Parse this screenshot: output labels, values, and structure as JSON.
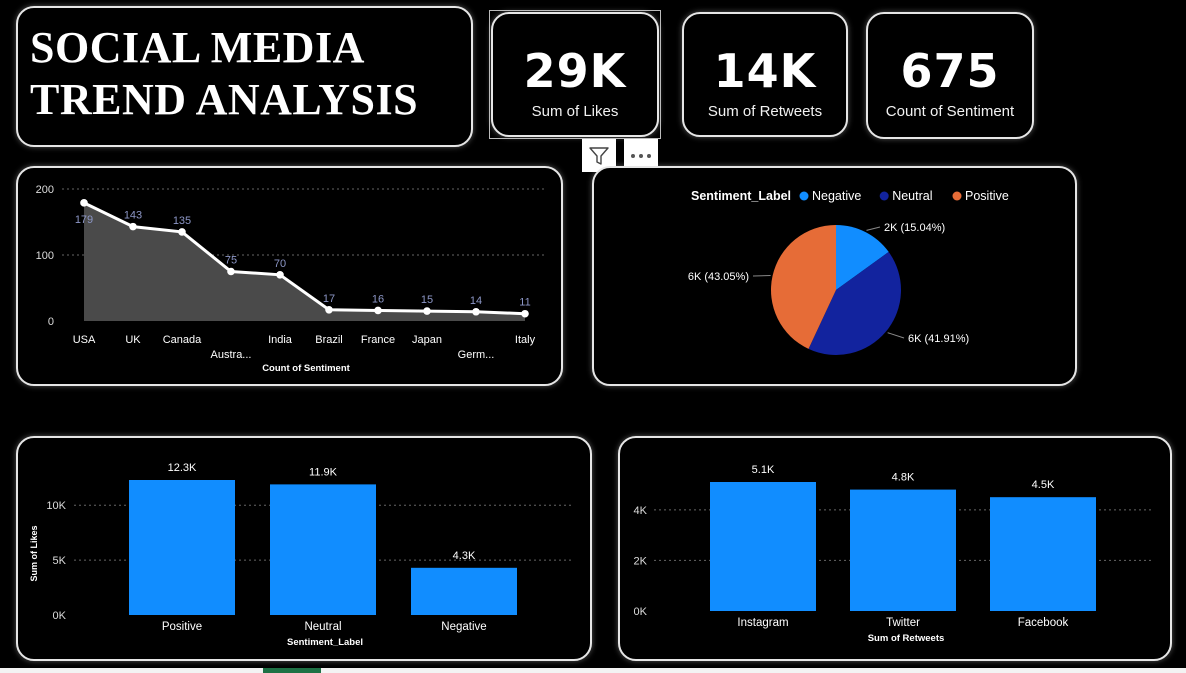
{
  "title": {
    "text": "SOCIAL MEDIA\nTREND ANALYSIS"
  },
  "kpis": [
    {
      "value": "29K",
      "label": "Sum of Likes"
    },
    {
      "value": "14K",
      "label": "Sum of Retweets"
    },
    {
      "value": "675",
      "label": "Count of Sentiment"
    }
  ],
  "toolbar": {
    "filter_icon": "filter-icon",
    "more_icon": "more-options-icon"
  },
  "colors": {
    "negative": "#118DFF",
    "neutral": "#12239E",
    "positive": "#E66C37",
    "bar": "#118DFF",
    "line": "#FFFFFF",
    "area": "#4a4a4a",
    "line_label": "#8c96c6"
  },
  "chart_data": [
    {
      "type": "area",
      "categories": [
        "USA",
        "UK",
        "Canada",
        "Austra...",
        "India",
        "Brazil",
        "France",
        "Japan",
        "Germ...",
        "Italy"
      ],
      "values": [
        179,
        143,
        135,
        75,
        70,
        17,
        16,
        15,
        14,
        11
      ],
      "data_labels": [
        "179",
        "143",
        "135",
        "75",
        "70",
        "17",
        "16",
        "15",
        "14",
        "11"
      ],
      "xlabel": "Count of Sentiment",
      "ylabel": "",
      "ylim": [
        0,
        200
      ],
      "yticks": [
        0,
        100,
        200
      ],
      "ytick_labels": [
        "0",
        "100",
        "200"
      ],
      "grid": true
    },
    {
      "type": "pie",
      "legend_title": "Sentiment_Label",
      "legend_position": "top",
      "labels": [
        "Negative",
        "Neutral",
        "Positive"
      ],
      "values": [
        15.04,
        41.91,
        43.05
      ],
      "data_labels": [
        "2K (15.04%)",
        "6K (41.91%)",
        "6K (43.05%)"
      ]
    },
    {
      "type": "bar",
      "categories": [
        "Positive",
        "Neutral",
        "Negative"
      ],
      "values": [
        12300,
        11900,
        4300
      ],
      "data_labels": [
        "12.3K",
        "11.9K",
        "4.3K"
      ],
      "xlabel": "Sentiment_Label",
      "ylabel": "Sum of Likes",
      "ylim": [
        0,
        12300
      ],
      "yticks": [
        0,
        5000,
        10000
      ],
      "ytick_labels": [
        "0K",
        "5K",
        "10K"
      ],
      "grid": true
    },
    {
      "type": "bar",
      "categories": [
        "Instagram",
        "Twitter",
        "Facebook"
      ],
      "values": [
        5100,
        4800,
        4500
      ],
      "data_labels": [
        "5.1K",
        "4.8K",
        "4.5K"
      ],
      "xlabel": "Sum of Retweets",
      "ylabel": "",
      "ylim": [
        0,
        5100
      ],
      "yticks": [
        0,
        2000,
        4000
      ],
      "ytick_labels": [
        "0K",
        "2K",
        "4K"
      ],
      "grid": true
    }
  ]
}
